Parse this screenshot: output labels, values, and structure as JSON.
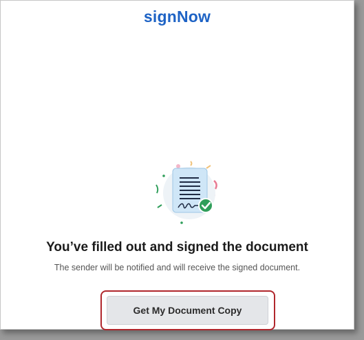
{
  "header": {
    "logo_text": "signNow"
  },
  "illustration": {
    "icon": "signed-document-icon",
    "check_color": "#2f9e5a",
    "doc_color": "#cfe6f7"
  },
  "message": {
    "title": "You’ve filled out and signed the document",
    "subtitle": "The sender will be notified and will receive the signed document."
  },
  "actions": {
    "primary_label": "Get My Document Copy"
  },
  "colors": {
    "brand": "#1e63c5",
    "highlight": "#b0262c"
  }
}
